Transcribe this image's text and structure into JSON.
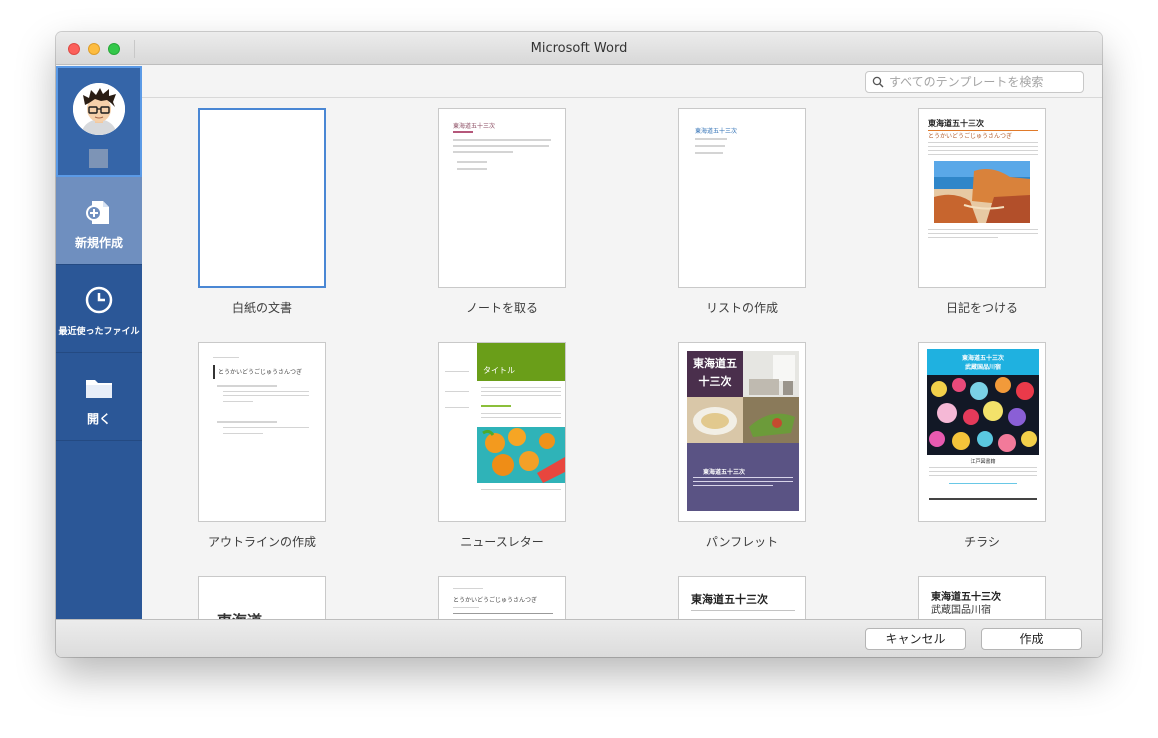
{
  "window": {
    "title": "Microsoft Word"
  },
  "sidebar": {
    "items": [
      {
        "label": "新規作成",
        "icon": "new-document-icon"
      },
      {
        "label": "最近使ったファイル",
        "icon": "clock-icon"
      },
      {
        "label": "開く",
        "icon": "folder-icon"
      }
    ]
  },
  "search": {
    "placeholder": "すべてのテンプレートを検索"
  },
  "templates": [
    {
      "label": "白紙の文書"
    },
    {
      "label": "ノートを取る",
      "heading": "東海道五十三次"
    },
    {
      "label": "リストの作成",
      "heading": "東海道五十三次"
    },
    {
      "label": "日記をつける",
      "heading": "東海道五十三次",
      "subheading": "とうかいどうごじゅうさんつぎ"
    },
    {
      "label": "アウトラインの作成",
      "subheading": "とうかいどうごじゅうさんつぎ"
    },
    {
      "label": "ニュースレター",
      "heading": "タイトル"
    },
    {
      "label": "パンフレット",
      "heading": "東海道五十三次",
      "subheading": "東海道五十三次"
    },
    {
      "label": "チラシ",
      "heading": "東海道五十三次",
      "subheading": "武蔵国品川宿",
      "body_heading": "江戸図書籍"
    },
    {
      "label": "",
      "heading": "東海道"
    },
    {
      "label": "",
      "subheading": "とうかいどうごじゅうさんつぎ"
    },
    {
      "label": "",
      "heading": "東海道五十三次"
    },
    {
      "label": "",
      "heading": "東海道五十三次",
      "subheading": "武蔵国品川宿"
    }
  ],
  "footer": {
    "cancel_label": "キャンセル",
    "create_label": "作成"
  },
  "colors": {
    "sidebar": "#2b5797",
    "selected": "#4a87d4",
    "flyer_header": "#1fb1e0",
    "newsletter_green": "#6a9e19",
    "pamphlet_purple": "#5a5384"
  }
}
